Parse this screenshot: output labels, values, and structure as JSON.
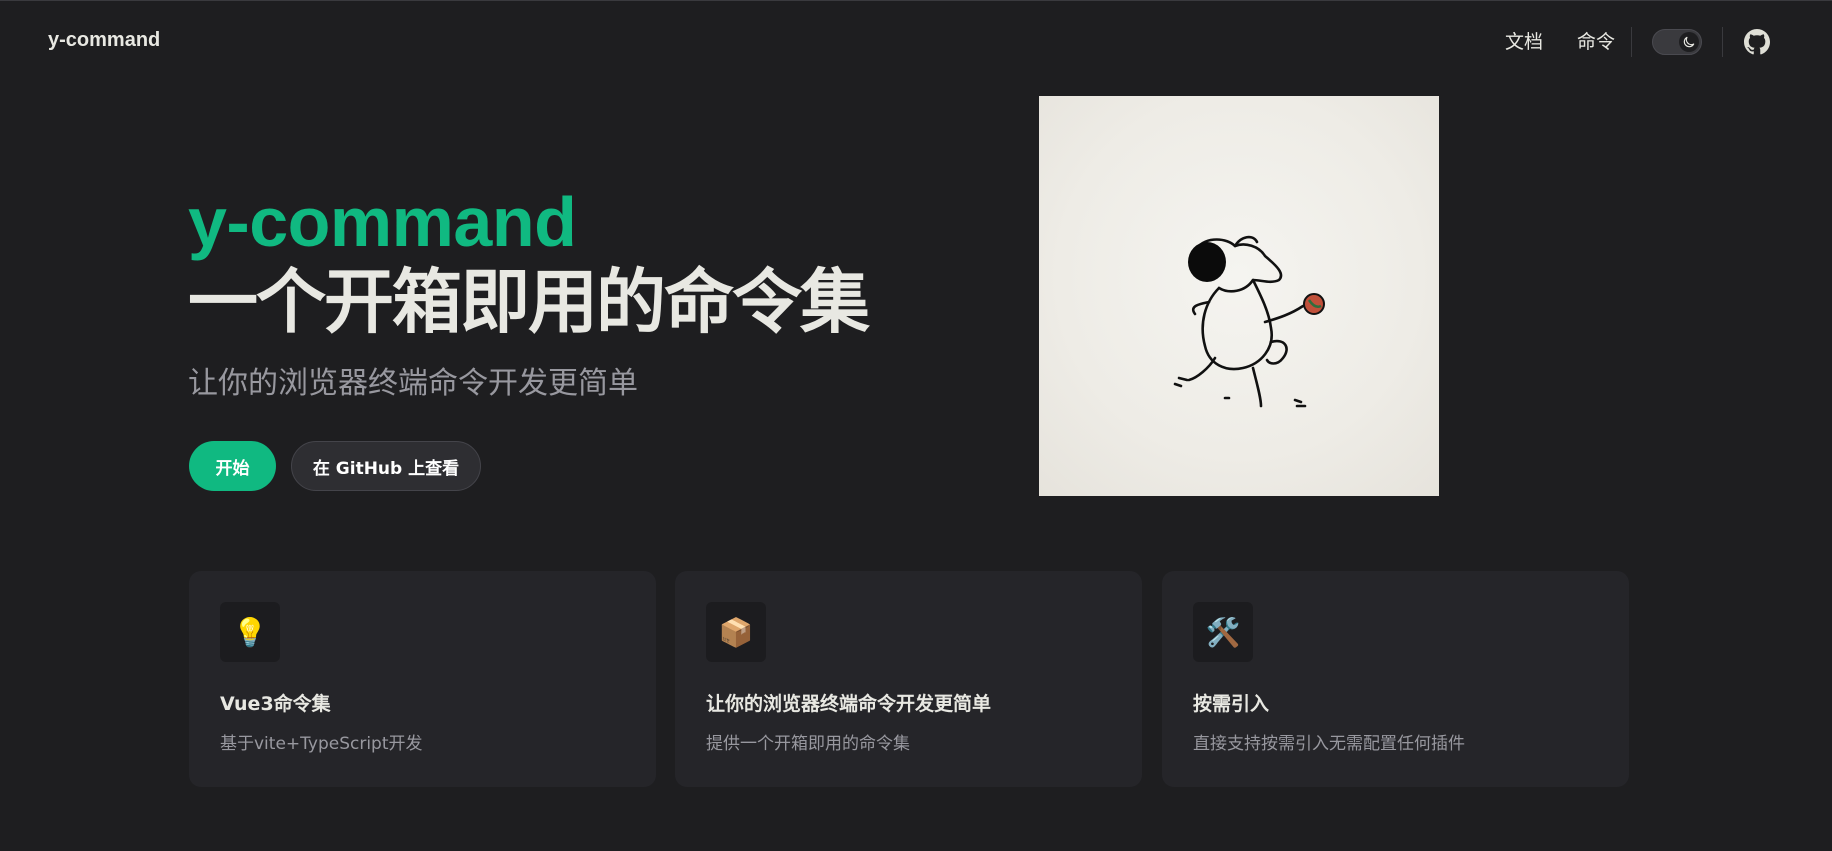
{
  "nav": {
    "brand": "y-command",
    "links": [
      "文档",
      "命令"
    ],
    "theme_toggle_icon": "moon-icon",
    "github_icon": "github-icon"
  },
  "hero": {
    "name": "y-command",
    "text": "一个开箱即用的命令集",
    "tagline": "让你的浏览器终端命令开发更简单",
    "actions": {
      "start": "开始",
      "github": "在 GitHub 上查看"
    },
    "image_icon": "mouse-illustration"
  },
  "features": [
    {
      "icon": "💡",
      "icon_name": "lightbulb-icon",
      "title": "Vue3命令集",
      "details": "基于vite+TypeScript开发"
    },
    {
      "icon": "📦",
      "icon_name": "package-icon",
      "title": "让你的浏览器终端命令开发更简单",
      "details": "提供一个开箱即用的命令集"
    },
    {
      "icon": "🛠️",
      "icon_name": "tools-icon",
      "title": "按需引入",
      "details": "直接支持按需引入无需配置任何插件"
    }
  ],
  "colors": {
    "background": "#1e1e20",
    "brand": "#10b981",
    "card": "#252529",
    "text_muted": "#98989f"
  }
}
